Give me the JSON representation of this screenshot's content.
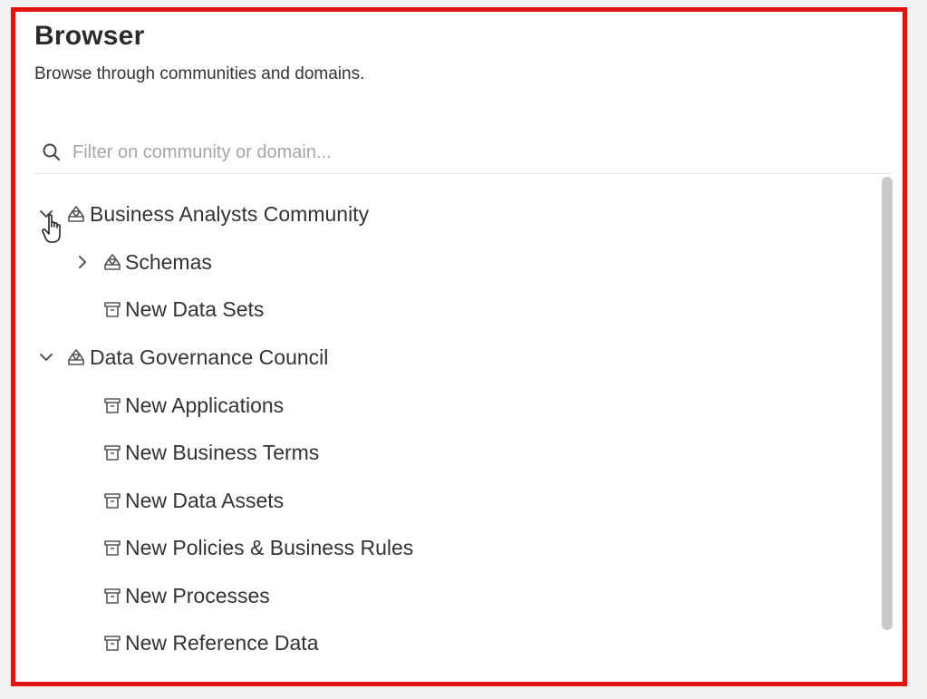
{
  "panel": {
    "title": "Browser",
    "subtitle": "Browse through communities and domains."
  },
  "filter": {
    "placeholder": "Filter on community or domain...",
    "value": ""
  },
  "tree": [
    {
      "label": "Business Analysts Community",
      "kind": "community",
      "expanded": true
    },
    {
      "label": "Schemas",
      "kind": "community",
      "expanded": false
    },
    {
      "label": "New Data Sets",
      "kind": "domain"
    },
    {
      "label": "Data Governance Council",
      "kind": "community",
      "expanded": true
    },
    {
      "label": "New Applications",
      "kind": "domain"
    },
    {
      "label": "New Business Terms",
      "kind": "domain"
    },
    {
      "label": "New Data Assets",
      "kind": "domain"
    },
    {
      "label": "New Policies & Business Rules",
      "kind": "domain"
    },
    {
      "label": "New Processes",
      "kind": "domain"
    },
    {
      "label": "New Reference Data",
      "kind": "domain"
    }
  ],
  "icons": {
    "search": "search-icon",
    "community": "community-icon",
    "domain": "domain-icon",
    "expanded": "chevron-down-icon",
    "collapsed": "chevron-right-icon"
  },
  "colors": {
    "border": "#e1130f",
    "text": "#333333",
    "placeholder": "#a6a6a6",
    "scrollbar": "#c9c9c9"
  }
}
